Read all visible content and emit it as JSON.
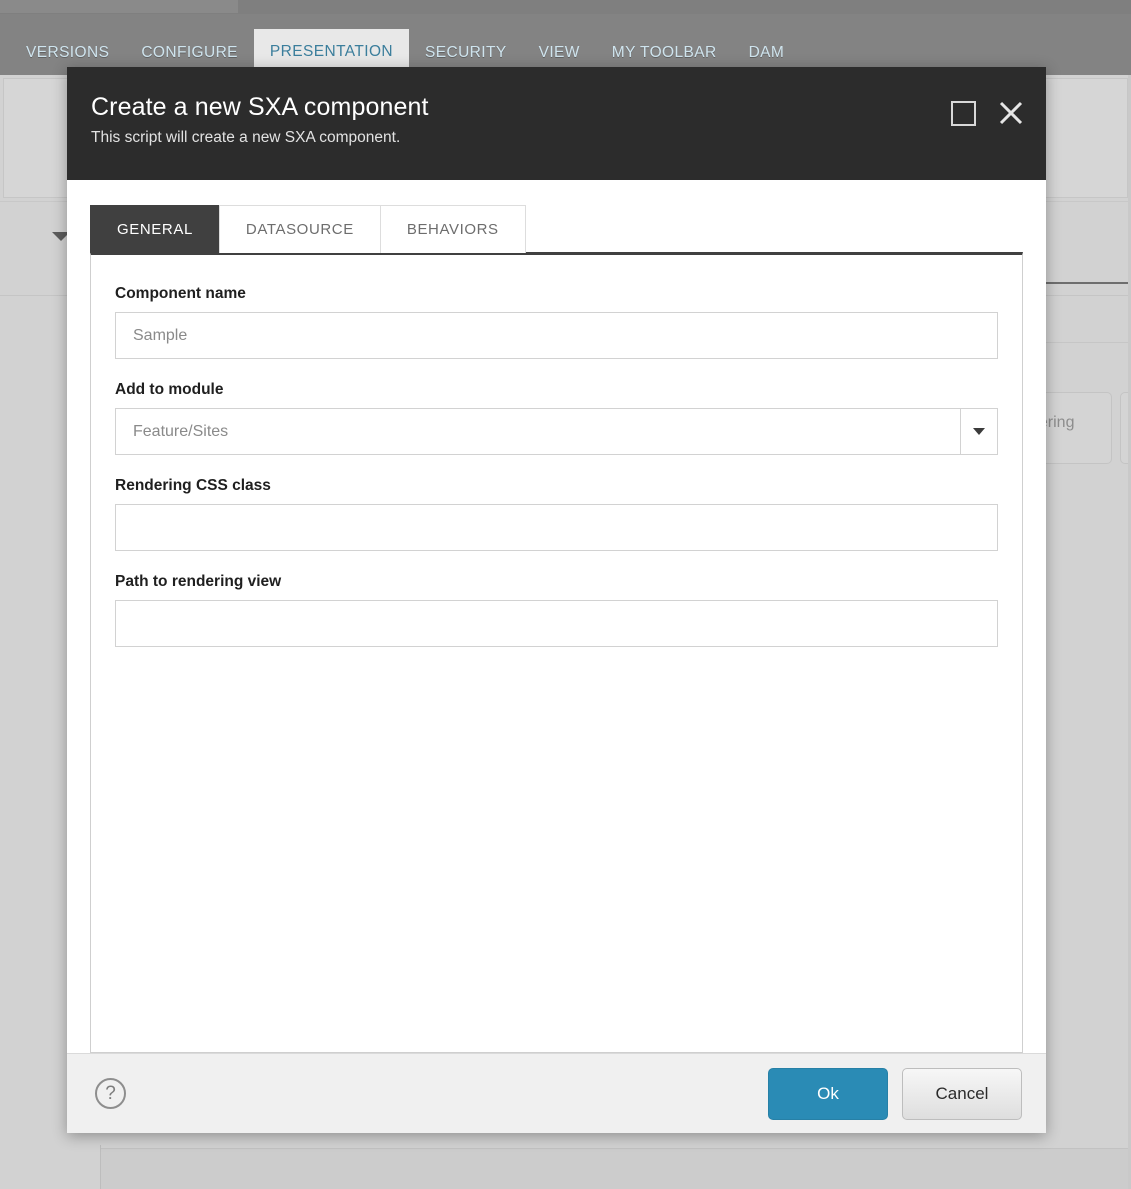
{
  "background": {
    "ribbon_tabs": [
      {
        "label": "VERSIONS",
        "active": false
      },
      {
        "label": "CONFIGURE",
        "active": false
      },
      {
        "label": "PRESENTATION",
        "active": true
      },
      {
        "label": "SECURITY",
        "active": false
      },
      {
        "label": "VIEW",
        "active": false
      },
      {
        "label": "MY TOOLBAR",
        "active": false
      },
      {
        "label": "DAM",
        "active": false
      }
    ],
    "partial_button_label": "dering"
  },
  "dialog": {
    "title": "Create a new SXA component",
    "subtitle": "This script will create a new SXA component.",
    "window_controls": {
      "maximize_icon": "maximize-icon",
      "close_icon": "close-icon"
    },
    "tabs": [
      {
        "label": "GENERAL",
        "active": true
      },
      {
        "label": "DATASOURCE",
        "active": false
      },
      {
        "label": "BEHAVIORS",
        "active": false
      }
    ],
    "fields": [
      {
        "label": "Component name",
        "value": "",
        "placeholder": "Sample",
        "type": "text"
      },
      {
        "label": "Add to module",
        "value": "",
        "placeholder": "Feature/Sites",
        "type": "select",
        "dropdown_icon": "chevron-down-icon"
      },
      {
        "label": "Rendering CSS class",
        "value": "",
        "placeholder": "",
        "type": "text"
      },
      {
        "label": "Path to rendering view",
        "value": "",
        "placeholder": "",
        "type": "text"
      }
    ],
    "footer": {
      "help_icon": "question-mark-icon",
      "help_glyph": "?",
      "ok_label": "Ok",
      "cancel_label": "Cancel"
    }
  },
  "colors": {
    "dialog_header_bg": "#2c2c2c",
    "active_tab_bg": "#404040",
    "ok_button_bg": "#2a8bb5",
    "ribbon_bg": "#838383",
    "ribbon_text": "#cfe4ee",
    "ribbon_active_text": "#3b7e9c"
  }
}
